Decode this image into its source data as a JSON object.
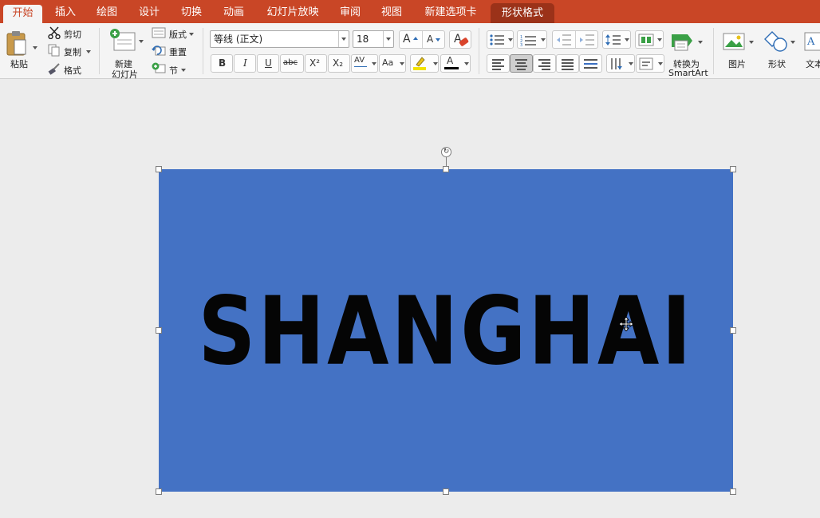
{
  "tabs": [
    {
      "label": "开始"
    },
    {
      "label": "插入"
    },
    {
      "label": "绘图"
    },
    {
      "label": "设计"
    },
    {
      "label": "切换"
    },
    {
      "label": "动画"
    },
    {
      "label": "幻灯片放映"
    },
    {
      "label": "审阅"
    },
    {
      "label": "视图"
    },
    {
      "label": "新建选项卡"
    },
    {
      "label": "形状格式"
    }
  ],
  "clipboard": {
    "paste": "粘贴",
    "cut": "剪切",
    "copy": "复制",
    "format": "格式"
  },
  "slides": {
    "new_slide_line1": "新建",
    "new_slide_line2": "幻灯片",
    "layout": "版式",
    "reset": "重置",
    "section": "节"
  },
  "font": {
    "name": "等线 (正文)",
    "size": "18",
    "bold": "B",
    "italic": "I",
    "underline": "U",
    "strike": "abc",
    "superscript": "X²",
    "subscript": "X₂",
    "char_spacing": "AV",
    "change_case": "Aa",
    "font_color": "A"
  },
  "paragraph": {
    "convert_line1": "转换为",
    "convert_line2": "SmartArt"
  },
  "insert": {
    "picture": "图片",
    "shape": "形状",
    "text": "文本"
  },
  "colors": {
    "accent": "#c94626",
    "context_tab": "#9b3219",
    "shape_fill": "#4472c4",
    "highlight": "#f2e200"
  },
  "slide": {
    "shape_text": "SHANGHAI"
  }
}
